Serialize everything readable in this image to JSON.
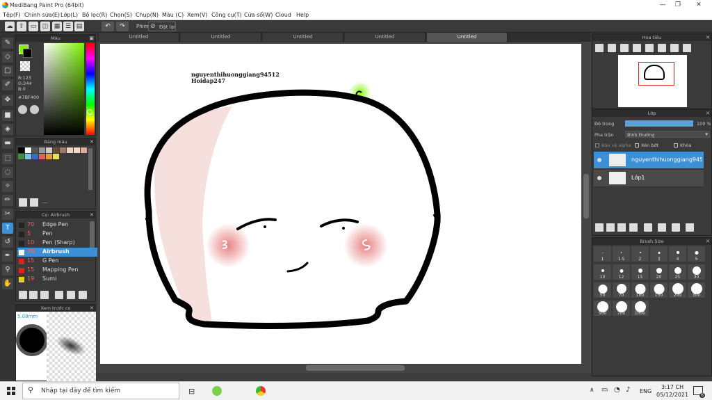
{
  "window": {
    "title": "MediBang Paint Pro (64bit)",
    "min": "—",
    "max": "❐",
    "close": "✕"
  },
  "menu": [
    "Tệp(F)",
    "Chỉnh sửa(E)",
    "Lớp(L)",
    "Bộ lọc(R)",
    "Chọn(S)",
    "Chụp(N)",
    "Màu (C)",
    "Xem(V)",
    "Công cụ(T)",
    "Cửa sổ(W)",
    "Cloud",
    "Help"
  ],
  "toolbar": {
    "key_label": "Phím",
    "reset_label": "Đặt lại"
  },
  "tabs": [
    "Untitled",
    "Untitled",
    "Untitled",
    "Untitled",
    "Untitled"
  ],
  "color_panel": {
    "title": "Màu",
    "r": "R:123",
    "g": "G:244",
    "b": "B:0",
    "hex": "#7BF400",
    "fg_color": "#7BF400",
    "bg_color": "#000000"
  },
  "palette_panel": {
    "title": "Bảng màu",
    "dash": "---",
    "swatches": [
      "#000000",
      "#ffffff",
      "#555555",
      "#999999",
      "#cccccc",
      "#6b4a2b",
      "#a0786a",
      "#e9d3c4",
      "#f2dcc9",
      "#e6a9a0",
      "#3d8f3d",
      "#7cc2e5",
      "#3a6ac8",
      "#e06060",
      "#e89a3a",
      "#e6e05a"
    ]
  },
  "brush_panel": {
    "title": "Cọ: Airbrush",
    "items": [
      {
        "size": "70",
        "name": "Edge Pen",
        "color": "#222222"
      },
      {
        "size": "5",
        "name": "Pen",
        "color": "#222222"
      },
      {
        "size": "10",
        "name": "Pen (Sharp)",
        "color": "#222222"
      },
      {
        "size": "70",
        "name": "Airbrush",
        "color": "#ffffff"
      },
      {
        "size": "15",
        "name": "G Pen",
        "color": "#e02020"
      },
      {
        "size": "15",
        "name": "Mapping Pen",
        "color": "#e02020"
      },
      {
        "size": "19",
        "name": "Sumi",
        "color": "#e6d020"
      }
    ]
  },
  "preview_panel": {
    "title": "Xem trước cọ",
    "size": "5.08mm"
  },
  "navigator": {
    "title": "Hoa tiêu"
  },
  "layer_panel": {
    "title": "Lớp",
    "opacity_label": "Độ trong",
    "opacity_value": "100 %",
    "opacity": 1.0,
    "blend_label": "Pha trộn",
    "blend_value": "Bình thường",
    "protect_alpha": "Bảo vệ alpha",
    "clip": "Xén bớt",
    "lock": "Khóa",
    "layers": [
      {
        "name": "nguyenthihuonggiang94512"
      },
      {
        "name": "Lớp1"
      }
    ]
  },
  "brush_size_panel": {
    "title": "Brush Size",
    "sizes": [
      "1",
      "1.5",
      "2",
      "3",
      "4",
      "5",
      "10",
      "12",
      "15",
      "20",
      "25",
      "30",
      "50",
      "70",
      "100",
      "150",
      "200",
      "300",
      "500",
      "700",
      "1000"
    ]
  },
  "canvas_text": {
    "line1": "nguyenthihuonggiang94512",
    "line2": "Hoidap247"
  },
  "taskbar": {
    "search_placeholder": "Nhập tại đây để tìm kiếm",
    "lang": "ENG",
    "time": "3:17 CH",
    "date": "05/12/2021",
    "notif_count": "6"
  }
}
